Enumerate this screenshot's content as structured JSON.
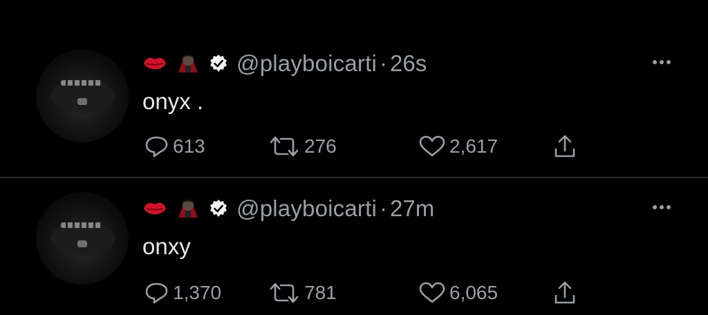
{
  "colors": {
    "background": "#000000",
    "text": "#e7e9ea",
    "muted": "#9a9fa5",
    "divider": "#2a2a2a"
  },
  "icons": {
    "lips": "lips-emoji-icon",
    "vampire": "vampire-emoji-icon",
    "verified": "verified-badge-icon",
    "more": "more-dots-icon",
    "reply": "reply-icon",
    "retweet": "retweet-icon",
    "like": "heart-icon",
    "share": "share-icon"
  },
  "tweets": [
    {
      "handle": "@playboicarti",
      "separator": "·",
      "time": "26s",
      "text": "onyx .",
      "replies": "613",
      "retweets": "276",
      "likes": "2,617"
    },
    {
      "handle": "@playboicarti",
      "separator": "·",
      "time": "27m",
      "text": "onxy",
      "replies": "1,370",
      "retweets": "781",
      "likes": "6,065"
    }
  ]
}
